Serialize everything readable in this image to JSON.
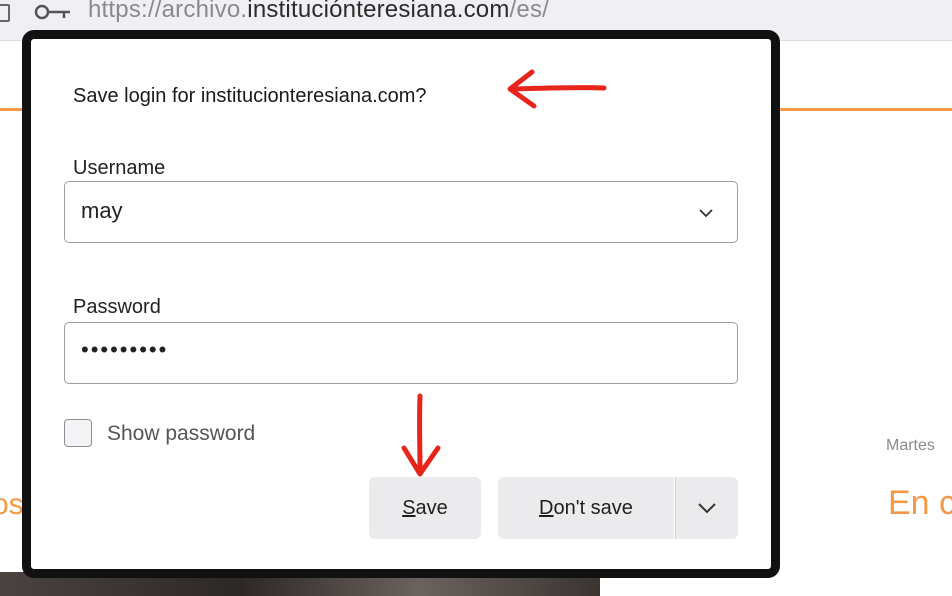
{
  "browser": {
    "url_prefix": "https://archivo.",
    "url_host": "instituciónteresiana.com",
    "url_suffix": "/es/"
  },
  "page": {
    "date_fragment": "Martes",
    "heading_fragment": "En c",
    "left_fragment": "os"
  },
  "dialog": {
    "title": "Save login for institucionteresiana.com?",
    "username_label": "Username",
    "username_value": "may",
    "password_label": "Password",
    "password_value": "•••••••••",
    "show_password_label": "Show password",
    "save_label": "Save",
    "save_mnemonic": "S",
    "save_rest": "ave",
    "dont_save_mnemonic": "D",
    "dont_save_rest": "on't save",
    "menu_icon": "chevron-down-icon"
  },
  "colors": {
    "accent_orange": "#f39a48",
    "annotation_red": "#e8251b",
    "dialog_border": "#111111",
    "button_bg": "#ebebee"
  }
}
